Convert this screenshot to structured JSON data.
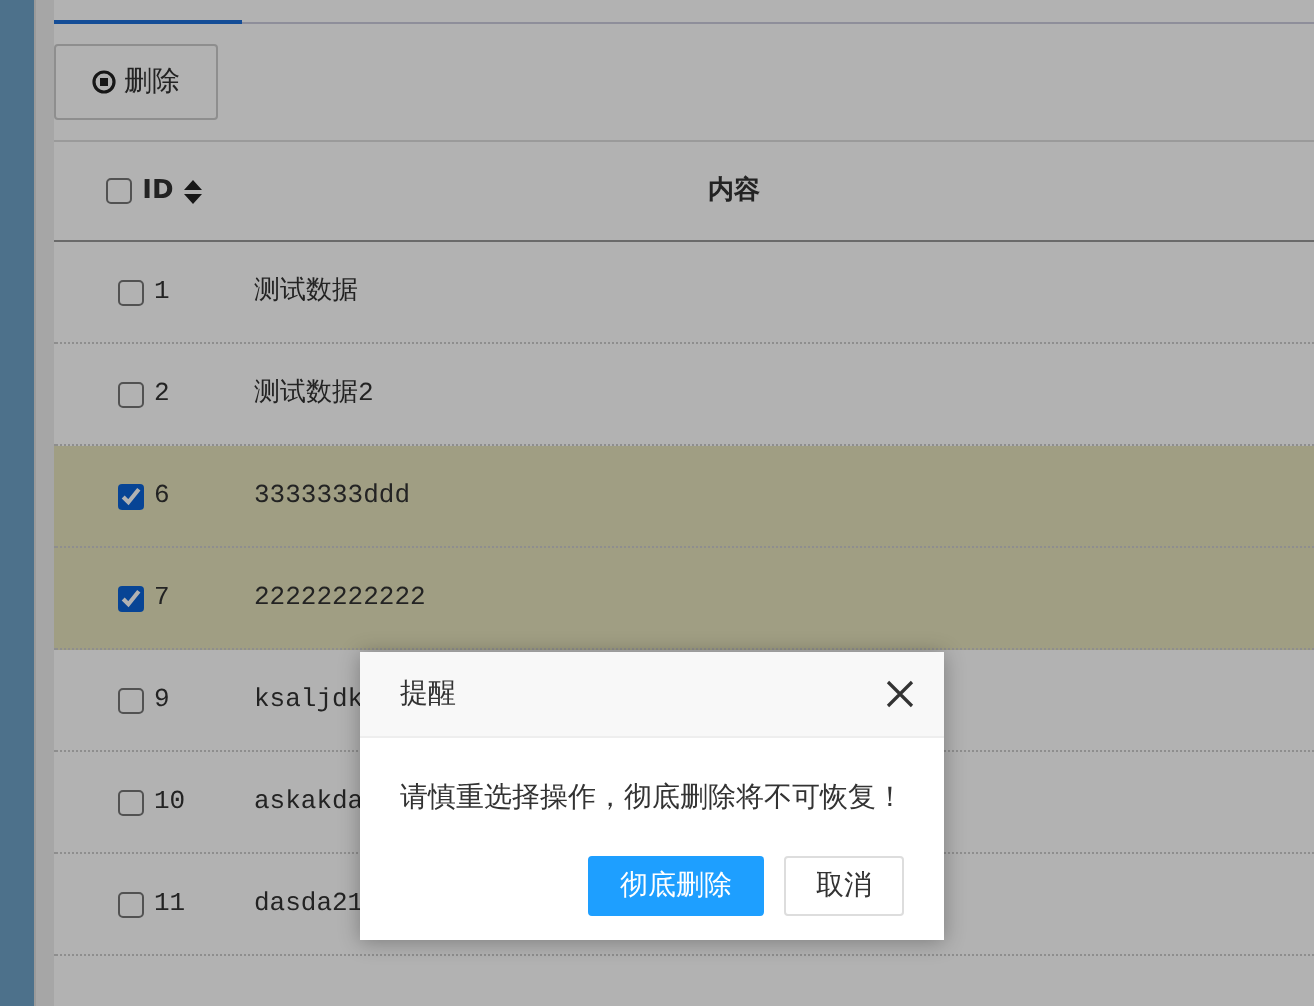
{
  "toolbar": {
    "delete_button": "删除"
  },
  "table": {
    "columns": [
      {
        "label": "ID",
        "checked": false
      },
      {
        "label": "内容"
      }
    ],
    "rows": [
      {
        "id": "1",
        "content": "测试数据",
        "checked": false
      },
      {
        "id": "2",
        "content": "测试数据2",
        "checked": false
      },
      {
        "id": "6",
        "content": "3333333ddd",
        "checked": true
      },
      {
        "id": "7",
        "content": "22222222222",
        "checked": true
      },
      {
        "id": "9",
        "content": "ksaljdk",
        "checked": false
      },
      {
        "id": "10",
        "content": "askakda",
        "checked": false
      },
      {
        "id": "11",
        "content": "dasda21",
        "checked": false
      }
    ]
  },
  "dialog": {
    "title": "提醒",
    "message": "请慎重选择操作，彻底删除将不可恢复！",
    "buttons": [
      {
        "label": "彻底删除",
        "kind": "primary"
      },
      {
        "label": "取消",
        "kind": "default"
      }
    ]
  }
}
